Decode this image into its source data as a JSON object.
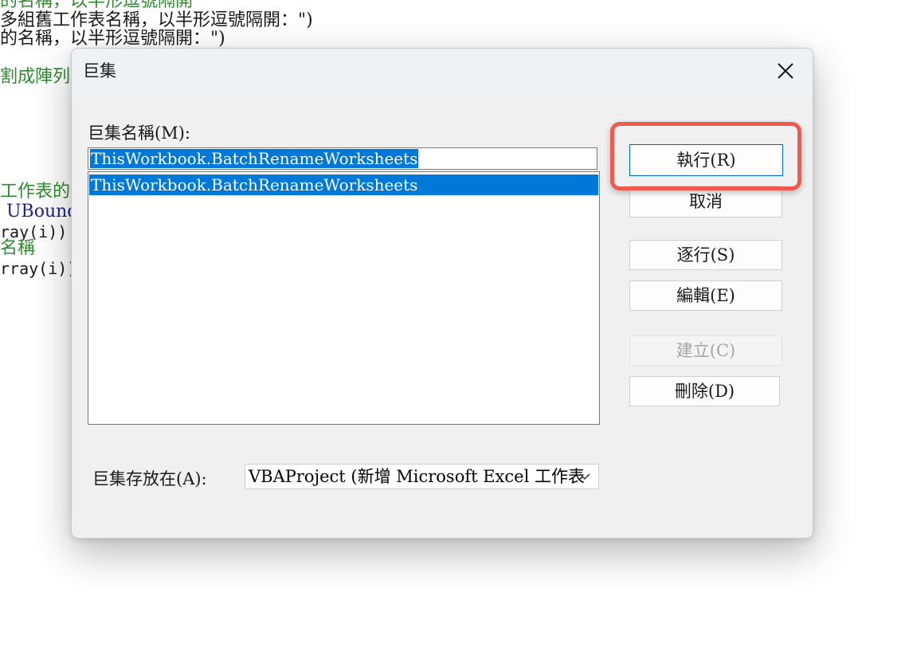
{
  "background_code": {
    "lines": [
      "的名稱，以半形逗號隔開",
      "多組舊工作表名稱，以半形逗號隔開：\")",
      "的名稱，以半形逗號隔開：\")",
      "割成陣列",
      "工作表的名",
      "UBound(",
      "ray(i))",
      "名稱",
      "rray(i))"
    ]
  },
  "dialog": {
    "title": "巨集",
    "macro_name_label": "巨集名稱(M):",
    "macro_name_value": "ThisWorkbook.BatchRenameWorksheets",
    "macro_list": [
      "ThisWorkbook.BatchRenameWorksheets"
    ],
    "buttons": {
      "run": "執行(R)",
      "cancel": "取消",
      "step": "逐行(S)",
      "edit": "編輯(E)",
      "create": "建立(C)",
      "delete": "刪除(D)"
    },
    "macros_in_label": "巨集存放在(A):",
    "macros_in_value": "VBAProject (新增 Microsoft Excel 工作表"
  },
  "colors": {
    "selection": "#0078d7",
    "highlight_ring": "#ef5a4f"
  }
}
